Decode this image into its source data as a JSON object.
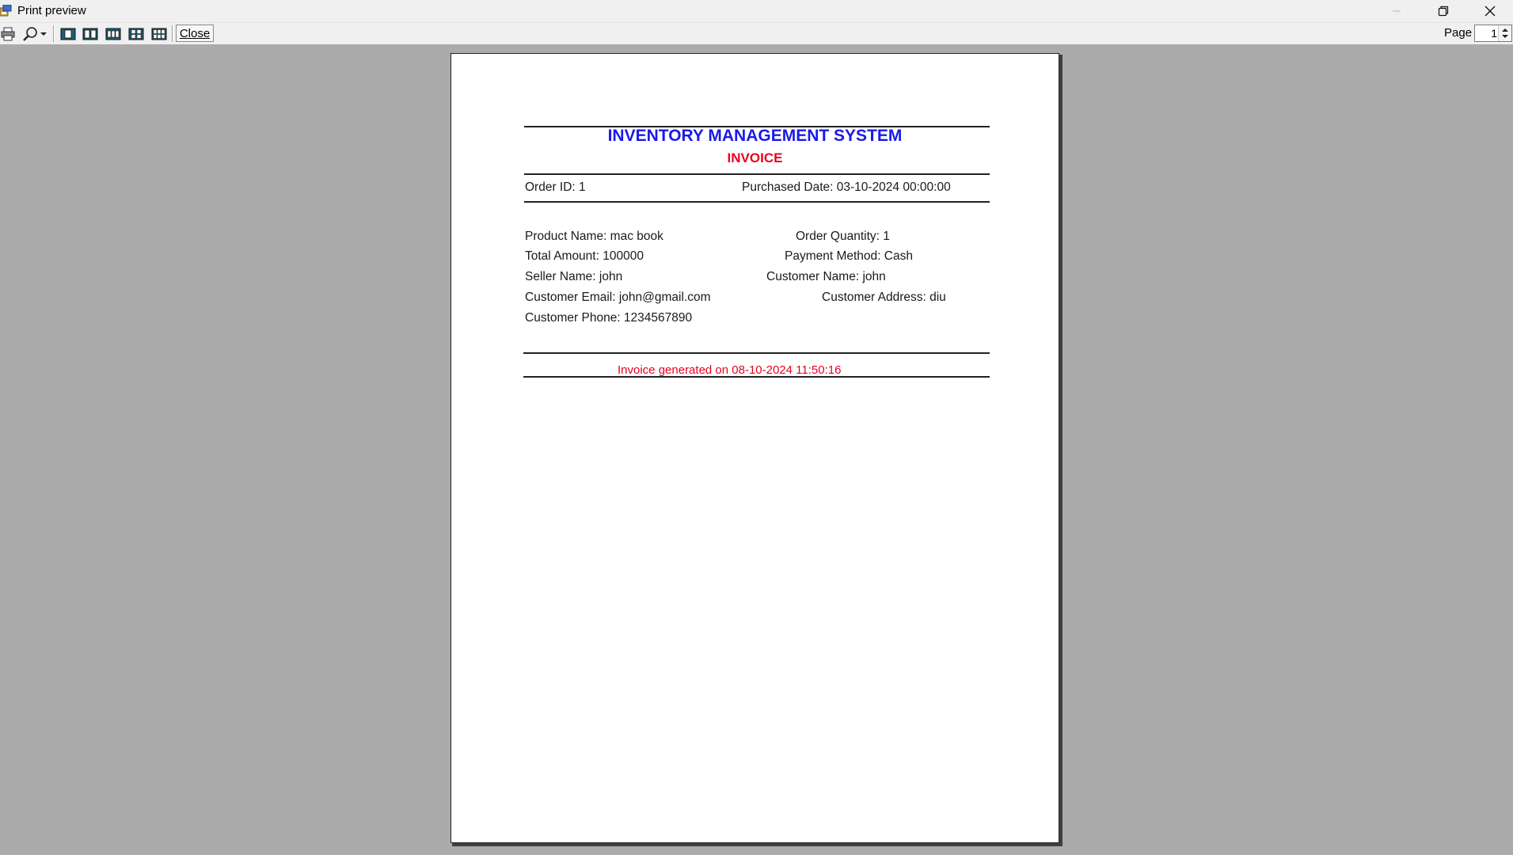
{
  "window": {
    "title": "Print preview"
  },
  "toolbar": {
    "close_label": "Close",
    "page_label": "Page",
    "page_value": "1",
    "icons": [
      "printer-icon",
      "zoom-icon",
      "one-page-icon",
      "two-pages-icon",
      "three-pages-icon",
      "four-pages-icon",
      "six-pages-icon"
    ]
  },
  "invoice": {
    "system_title": "INVENTORY MANAGEMENT SYSTEM",
    "heading": "INVOICE",
    "order_id": "Order ID: 1",
    "purchased_date": "Purchased Date: 03-10-2024 00:00:00",
    "product_name": "Product Name: mac book",
    "order_quantity": "Order Quantity: 1",
    "total_amount": "Total Amount: 100000",
    "payment_method": "Payment Method: Cash",
    "seller_name": "Seller Name: john",
    "customer_name": "Customer Name: john",
    "customer_email": "Customer Email: john@gmail.com",
    "customer_address": "Customer Address: diu",
    "customer_phone": "Customer Phone: 1234567890",
    "footer": "Invoice generated on 08-10-2024 11:50:16"
  },
  "colors": {
    "title_blue": "#1a1ae6",
    "accent_red": "#e8001f",
    "workspace_gray": "#ababab"
  }
}
